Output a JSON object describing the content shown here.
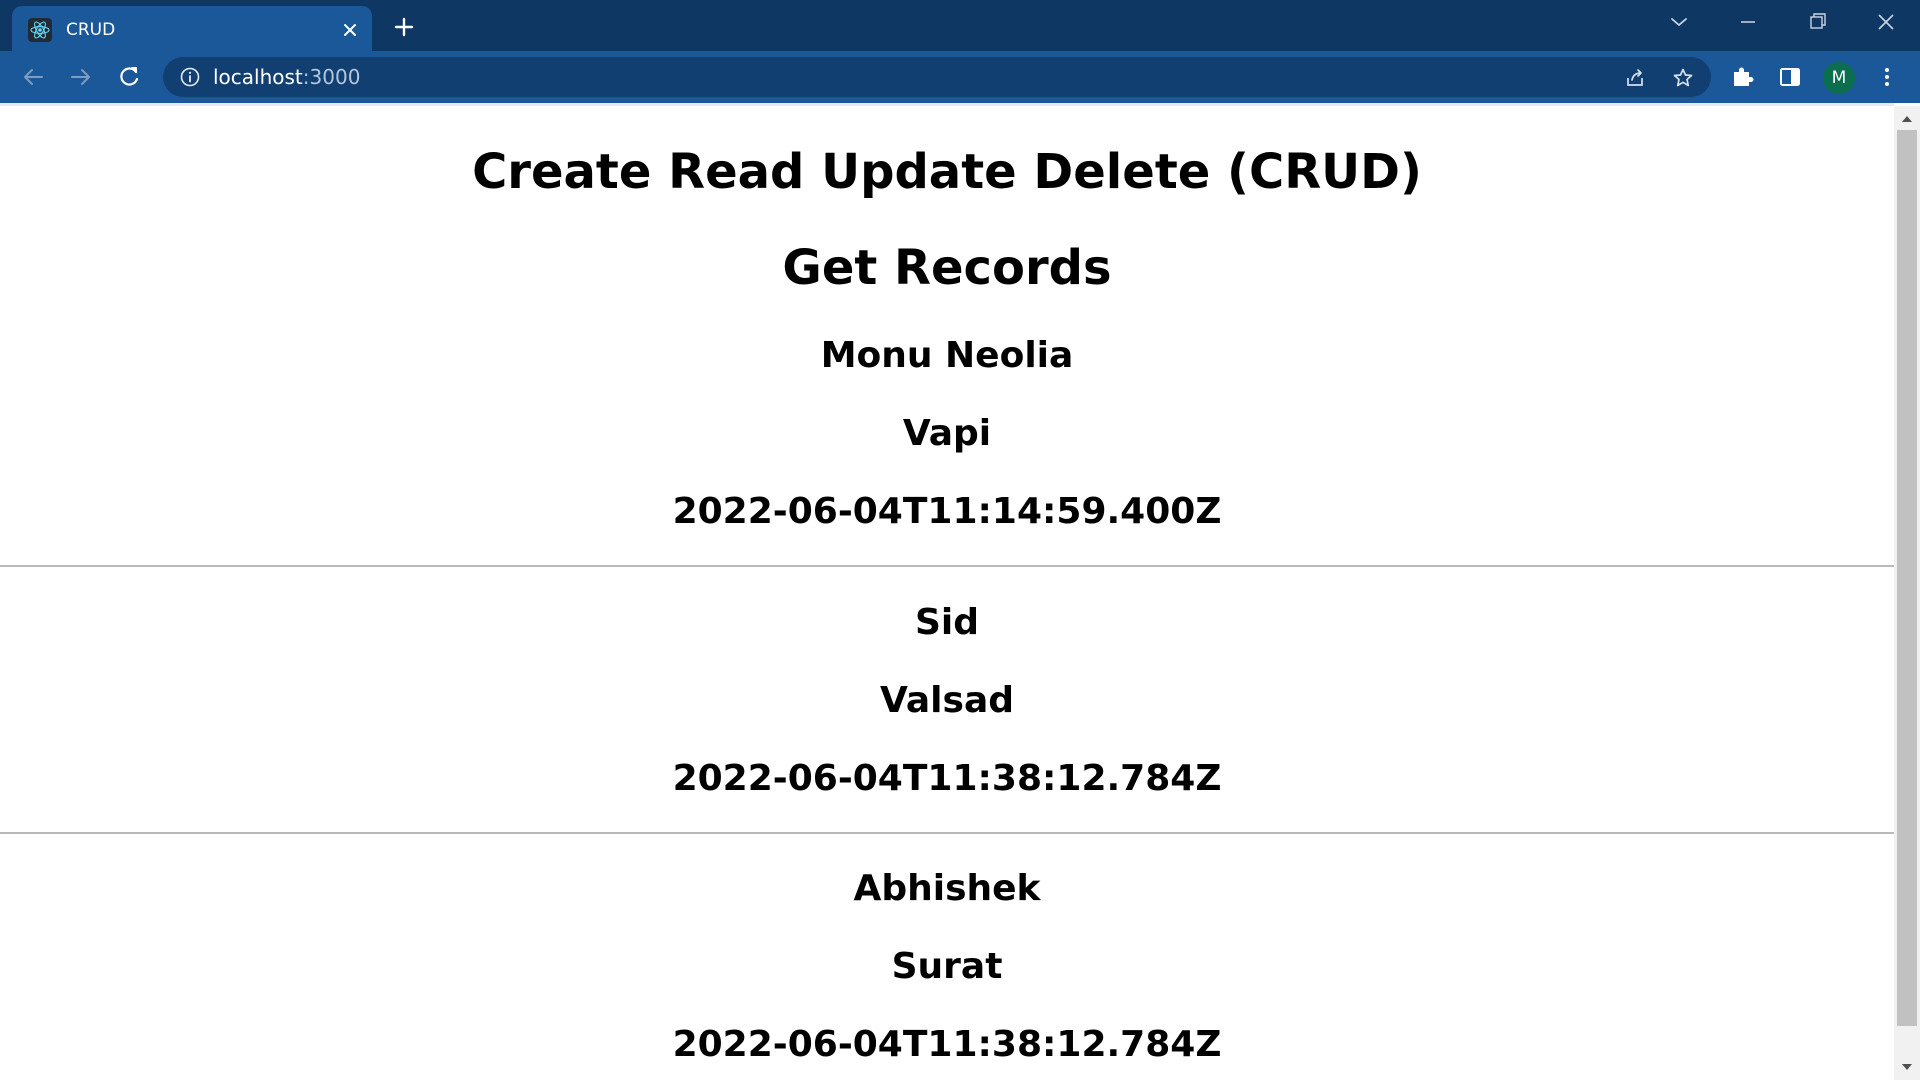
{
  "browser": {
    "tab": {
      "title": "CRUD",
      "favicon": "react-logo-icon"
    },
    "address_bar": {
      "host": "localhost",
      "port": ":3000"
    },
    "profile_initial": "M",
    "colors": {
      "tabstrip": "#0f3763",
      "toolbar": "#1b5899",
      "omnibox": "#113f72",
      "avatar": "#0b6e4f"
    }
  },
  "page": {
    "title": "Create Read Update Delete (CRUD)",
    "section_heading": "Get Records",
    "records": [
      {
        "name": "Monu Neolia",
        "city": "Vapi",
        "timestamp": "2022-06-04T11:14:59.400Z"
      },
      {
        "name": "Sid",
        "city": "Valsad",
        "timestamp": "2022-06-04T11:38:12.784Z"
      },
      {
        "name": "Abhishek",
        "city": "Surat",
        "timestamp": "2022-06-04T11:38:12.784Z"
      }
    ]
  }
}
